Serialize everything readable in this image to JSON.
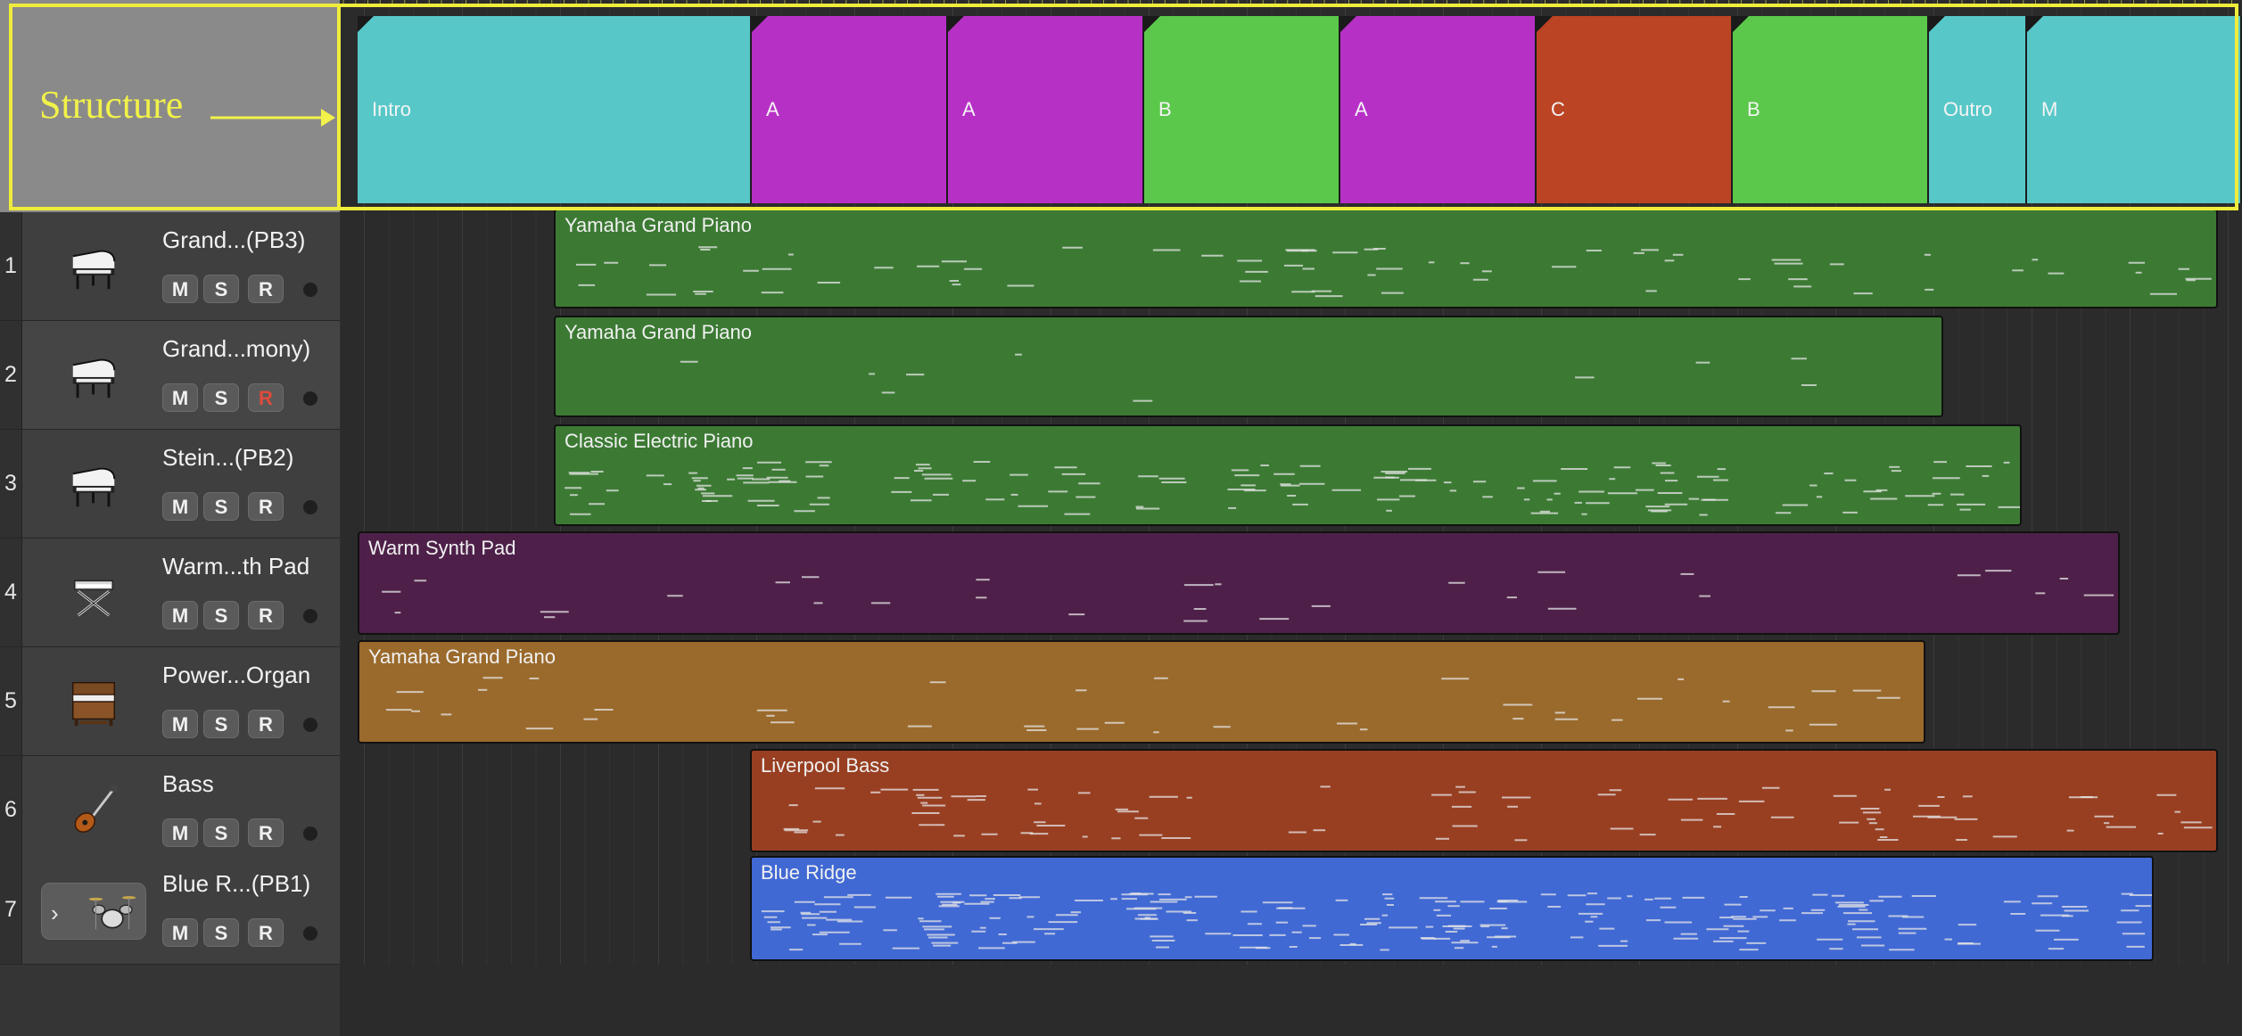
{
  "annotation": {
    "label": "Structure"
  },
  "arrangement": [
    {
      "label": "Intro",
      "color": "#58c7c8"
    },
    {
      "label": "A",
      "color": "#b730c6"
    },
    {
      "label": "A",
      "color": "#b730c6"
    },
    {
      "label": "B",
      "color": "#5bc84b"
    },
    {
      "label": "A",
      "color": "#b730c6"
    },
    {
      "label": "C",
      "color": "#bb4424"
    },
    {
      "label": "B",
      "color": "#5bc84b"
    },
    {
      "label": "Outro",
      "color": "#58c7c8"
    },
    {
      "label": "M",
      "color": "#58c7c8"
    }
  ],
  "tracks": [
    {
      "number": "1",
      "name": "Grand...(PB3)",
      "icon": "grand-piano-icon",
      "mute": "M",
      "solo": "S",
      "record": "R",
      "record_armed": false,
      "region": {
        "label": "Yamaha Grand Piano",
        "color": "#3c7a34"
      }
    },
    {
      "number": "2",
      "name": "Grand...mony)",
      "icon": "grand-piano-icon",
      "mute": "M",
      "solo": "S",
      "record": "R",
      "record_armed": true,
      "region": {
        "label": "Yamaha Grand Piano",
        "color": "#3c7a34"
      }
    },
    {
      "number": "3",
      "name": "Stein...(PB2)",
      "icon": "grand-piano-icon",
      "mute": "M",
      "solo": "S",
      "record": "R",
      "record_armed": false,
      "region": {
        "label": "Classic Electric Piano",
        "color": "#3c7a34"
      }
    },
    {
      "number": "4",
      "name": "Warm...th Pad",
      "icon": "keyboard-stand-icon",
      "mute": "M",
      "solo": "S",
      "record": "R",
      "record_armed": false,
      "region": {
        "label": "Warm Synth Pad",
        "color": "#4e2049"
      }
    },
    {
      "number": "5",
      "name": "Power...Organ",
      "icon": "organ-icon",
      "mute": "M",
      "solo": "S",
      "record": "R",
      "record_armed": false,
      "region": {
        "label": "Yamaha Grand Piano",
        "color": "#9a6a2c"
      }
    },
    {
      "number": "6",
      "name": "Bass",
      "icon": "bass-guitar-icon",
      "mute": "M",
      "solo": "S",
      "record": "R",
      "record_armed": false,
      "region": {
        "label": "Liverpool Bass",
        "color": "#983f22"
      }
    },
    {
      "number": "7",
      "name": "Blue R...(PB1)",
      "icon": "drum-kit-icon",
      "mute": "M",
      "solo": "S",
      "record": "R",
      "record_armed": false,
      "region": {
        "label": "Blue Ridge",
        "color": "#4169d4"
      }
    }
  ]
}
